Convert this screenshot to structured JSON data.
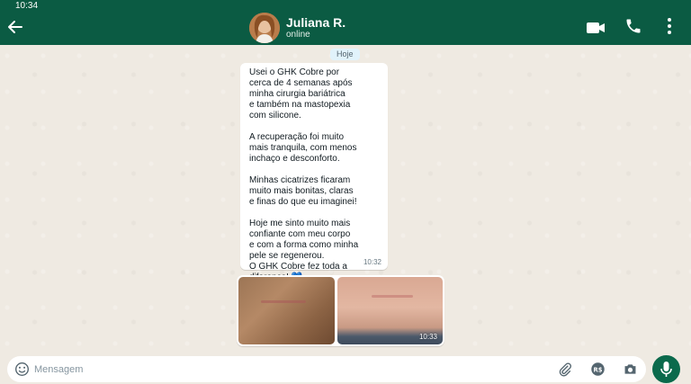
{
  "status_bar": {
    "time": "10:34"
  },
  "header": {
    "contact_name": "Juliana R.",
    "contact_status": "online"
  },
  "chat": {
    "date_chip": "Hoje",
    "message": {
      "text": "Usei o GHK Cobre por\ncerca de 4 semanas após\nminha cirurgia bariátrica\ne também na mastopexia\ncom silicone.\n\nA recuperação foi muito\nmais tranquila, com menos\ninchaço e desconforto.\n\nMinhas cicatrizes ficaram\nmuito mais bonitas, claras\ne finas do que eu imaginei!\n\nHoje me sinto muito mais\nconfiante com meu corpo\ne com a forma como minha\npele se regenerou.\nO GHK Cobre fez toda a\ndiferença! 💙",
      "time": "10:32"
    },
    "photos": {
      "time": "10:33"
    }
  },
  "input_bar": {
    "placeholder": "Mensagem",
    "value": ""
  },
  "icons": {
    "back": "back-arrow-icon",
    "video": "video-call-icon",
    "phone": "phone-icon",
    "menu": "more-vert-icon",
    "emoji": "emoji-icon",
    "attach": "paperclip-icon",
    "payment": "payment-icon",
    "camera": "camera-icon",
    "mic": "microphone-icon"
  },
  "colors": {
    "header": "#0b5b43",
    "chat_bg": "#efeae2",
    "mic_button": "#0b6a4c"
  }
}
